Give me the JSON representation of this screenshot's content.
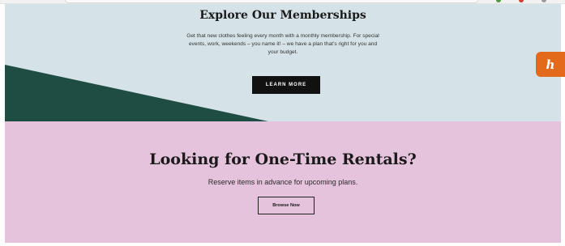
{
  "memberships": {
    "title": "Explore Our Memberships",
    "description": "Get that new clothes feeling every month with a monthly membership. For special events, work, weekends – you name it! – we have a plan that’s right for you and your budget.",
    "button_label": "LEARN MORE"
  },
  "rentals": {
    "title": "Looking for One-Time Rentals?",
    "subtitle": "Reserve items in advance for upcoming plans.",
    "button_label": "Browse Now"
  },
  "floating_widget": {
    "glyph": "h"
  },
  "colors": {
    "membership_bg": "#d5e3e8",
    "wedge": "#1f4d43",
    "rentals_bg": "#e5c3dc",
    "widget": "#e46a1b"
  }
}
